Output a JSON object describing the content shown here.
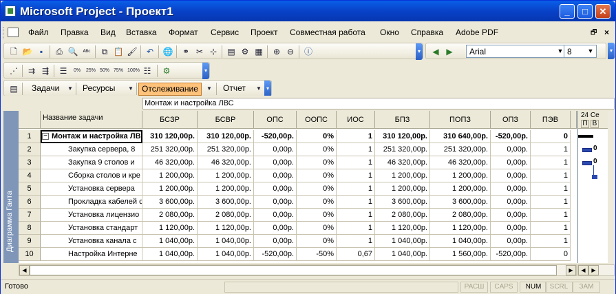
{
  "window": {
    "title": "Microsoft Project - Проект1"
  },
  "menu": [
    "Файл",
    "Правка",
    "Вид",
    "Вставка",
    "Формат",
    "Сервис",
    "Проект",
    "Совместная работа",
    "Окно",
    "Справка",
    "Adobe PDF"
  ],
  "toolbar": {
    "font": "Arial",
    "size": "8"
  },
  "views": {
    "tasks": "Задачи",
    "resources": "Ресурсы",
    "tracking": "Отслеживание",
    "report": "Отчет"
  },
  "zoom_buttons": [
    "0%",
    "25%",
    "50%",
    "75%",
    "100%"
  ],
  "entry_bar": "Монтаж и настройка ЛВС",
  "sidebar_label": "Диаграмма Ганта",
  "columns": [
    "Название задачи",
    "БСЗР",
    "БСВР",
    "ОПС",
    "ООПС",
    "ИОС",
    "БПЗ",
    "ПОПЗ",
    "ОПЗ",
    "ПЭВ"
  ],
  "rows": [
    {
      "id": "1",
      "name": "Монтаж и настройка ЛВ",
      "bszr": "310 120,00р.",
      "bsvr": "310 120,00р.",
      "ops": "-520,00р.",
      "oops": "0%",
      "ios": "1",
      "bpz": "310 120,00р.",
      "popz": "310 640,00р.",
      "opz": "-520,00р.",
      "pev": "0"
    },
    {
      "id": "2",
      "name": "Закупка сервера, 8",
      "bszr": "251 320,00р.",
      "bsvr": "251 320,00р.",
      "ops": "0,00р.",
      "oops": "0%",
      "ios": "1",
      "bpz": "251 320,00р.",
      "popz": "251 320,00р.",
      "opz": "0,00р.",
      "pev": "1"
    },
    {
      "id": "3",
      "name": "Закупка 9 столов и",
      "bszr": "46 320,00р.",
      "bsvr": "46 320,00р.",
      "ops": "0,00р.",
      "oops": "0%",
      "ios": "1",
      "bpz": "46 320,00р.",
      "popz": "46 320,00р.",
      "opz": "0,00р.",
      "pev": "1"
    },
    {
      "id": "4",
      "name": "Сборка столов и кре",
      "bszr": "1 200,00р.",
      "bsvr": "1 200,00р.",
      "ops": "0,00р.",
      "oops": "0%",
      "ios": "1",
      "bpz": "1 200,00р.",
      "popz": "1 200,00р.",
      "opz": "0,00р.",
      "pev": "1"
    },
    {
      "id": "5",
      "name": "Установка сервера",
      "bszr": "1 200,00р.",
      "bsvr": "1 200,00р.",
      "ops": "0,00р.",
      "oops": "0%",
      "ios": "1",
      "bpz": "1 200,00р.",
      "popz": "1 200,00р.",
      "opz": "0,00р.",
      "pev": "1"
    },
    {
      "id": "6",
      "name": "Прокладка кабелей с",
      "bszr": "3 600,00р.",
      "bsvr": "3 600,00р.",
      "ops": "0,00р.",
      "oops": "0%",
      "ios": "1",
      "bpz": "3 600,00р.",
      "popz": "3 600,00р.",
      "opz": "0,00р.",
      "pev": "1"
    },
    {
      "id": "7",
      "name": "Установка лицензио",
      "bszr": "2 080,00р.",
      "bsvr": "2 080,00р.",
      "ops": "0,00р.",
      "oops": "0%",
      "ios": "1",
      "bpz": "2 080,00р.",
      "popz": "2 080,00р.",
      "opz": "0,00р.",
      "pev": "1"
    },
    {
      "id": "8",
      "name": "Установка стандарт",
      "bszr": "1 120,00р.",
      "bsvr": "1 120,00р.",
      "ops": "0,00р.",
      "oops": "0%",
      "ios": "1",
      "bpz": "1 120,00р.",
      "popz": "1 120,00р.",
      "opz": "0,00р.",
      "pev": "1"
    },
    {
      "id": "9",
      "name": "Установка канала с",
      "bszr": "1 040,00р.",
      "bsvr": "1 040,00р.",
      "ops": "0,00р.",
      "oops": "0%",
      "ios": "1",
      "bpz": "1 040,00р.",
      "popz": "1 040,00р.",
      "opz": "0,00р.",
      "pev": "1"
    },
    {
      "id": "10",
      "name": "Настройка Интерне",
      "bszr": "1 040,00р.",
      "bsvr": "1 040,00р.",
      "ops": "-520,00р.",
      "oops": "-50%",
      "ios": "0,67",
      "bpz": "1 040,00р.",
      "popz": "1 560,00р.",
      "opz": "-520,00р.",
      "pev": "0"
    }
  ],
  "gantt": {
    "header": "24 Се",
    "days": [
      "П",
      "В"
    ],
    "labels": [
      "0",
      "0"
    ]
  },
  "status": {
    "ready": "Готово",
    "indicators": [
      "РАСШ",
      "CAPS",
      "NUM",
      "SCRL",
      "ЗАМ"
    ],
    "active": "NUM"
  },
  "colors": {
    "title_bar": "#0842c8",
    "active_view": "#ffc27a",
    "sidebar": "#7f96b8"
  }
}
